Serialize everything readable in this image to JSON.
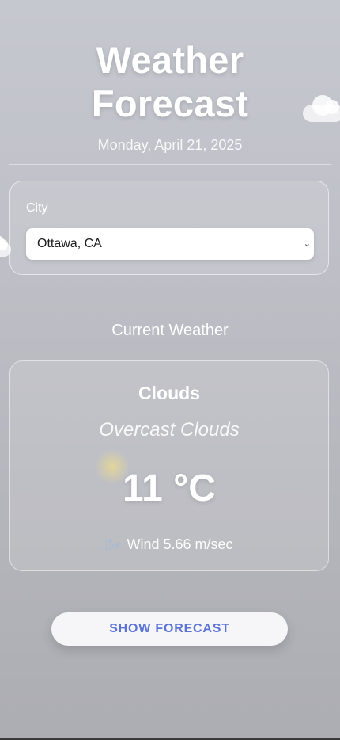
{
  "header": {
    "title_line1": "Weather",
    "title_line2": "Forecast",
    "date": "Monday, April 21, 2025"
  },
  "city": {
    "label": "City",
    "selected": "Ottawa, CA"
  },
  "current": {
    "section_title": "Current Weather",
    "condition": "Clouds",
    "description": "Overcast Clouds",
    "temperature": "11 °C",
    "wind": "Wind 5.66 m/sec",
    "wind_icon": "wind-icon"
  },
  "actions": {
    "show_forecast_label": "SHOW FORECAST"
  },
  "colors": {
    "accent": "#5b74d8",
    "background_top": "#c6c8d0",
    "background_bottom": "#acadb2"
  }
}
